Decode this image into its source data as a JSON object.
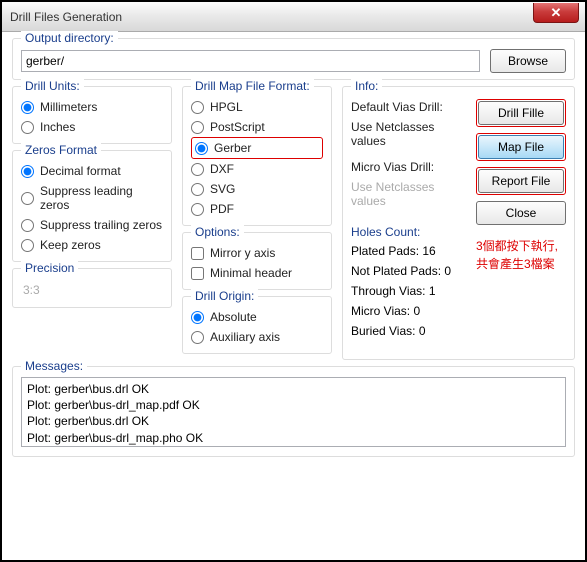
{
  "window": {
    "title": "Drill Files Generation"
  },
  "output": {
    "label": "Output directory:",
    "value": "gerber/",
    "browse": "Browse"
  },
  "drillUnits": {
    "title": "Drill Units:",
    "items": [
      "Millimeters",
      "Inches"
    ],
    "selected": 0
  },
  "zerosFormat": {
    "title": "Zeros Format",
    "items": [
      "Decimal format",
      "Suppress leading zeros",
      "Suppress trailing zeros",
      "Keep zeros"
    ],
    "selected": 0
  },
  "precision": {
    "title": "Precision",
    "value": "3:3"
  },
  "mapFormat": {
    "title": "Drill Map File Format:",
    "items": [
      "HPGL",
      "PostScript",
      "Gerber",
      "DXF",
      "SVG",
      "PDF"
    ],
    "selected": 2
  },
  "options": {
    "title": "Options:",
    "items": [
      "Mirror y axis",
      "Minimal header"
    ]
  },
  "drillOrigin": {
    "title": "Drill Origin:",
    "items": [
      "Absolute",
      "Auxiliary axis"
    ],
    "selected": 0
  },
  "info": {
    "title": "Info:",
    "defaultVias": "Default Vias Drill:",
    "useNet1": "Use Netclasses values",
    "microVias": "Micro Vias Drill:",
    "useNet2": "Use Netclasses values",
    "holesTitle": "Holes Count:",
    "holes": [
      "Plated Pads: 16",
      "Not Plated Pads: 0",
      "Through Vias: 1",
      "Micro Vias: 0",
      "Buried Vias: 0"
    ]
  },
  "buttons": {
    "drill": "Drill Fille",
    "map": "Map File",
    "report": "Report File",
    "close": "Close"
  },
  "annotation": {
    "l1": "3個都按下執行,",
    "l2": "共會產生3檔案"
  },
  "messages": {
    "title": "Messages:",
    "text": "Plot: gerber\\bus.drl OK\nPlot: gerber\\bus-drl_map.pdf OK\nPlot: gerber\\bus.drl OK\nPlot: gerber\\bus-drl_map.pho OK"
  }
}
